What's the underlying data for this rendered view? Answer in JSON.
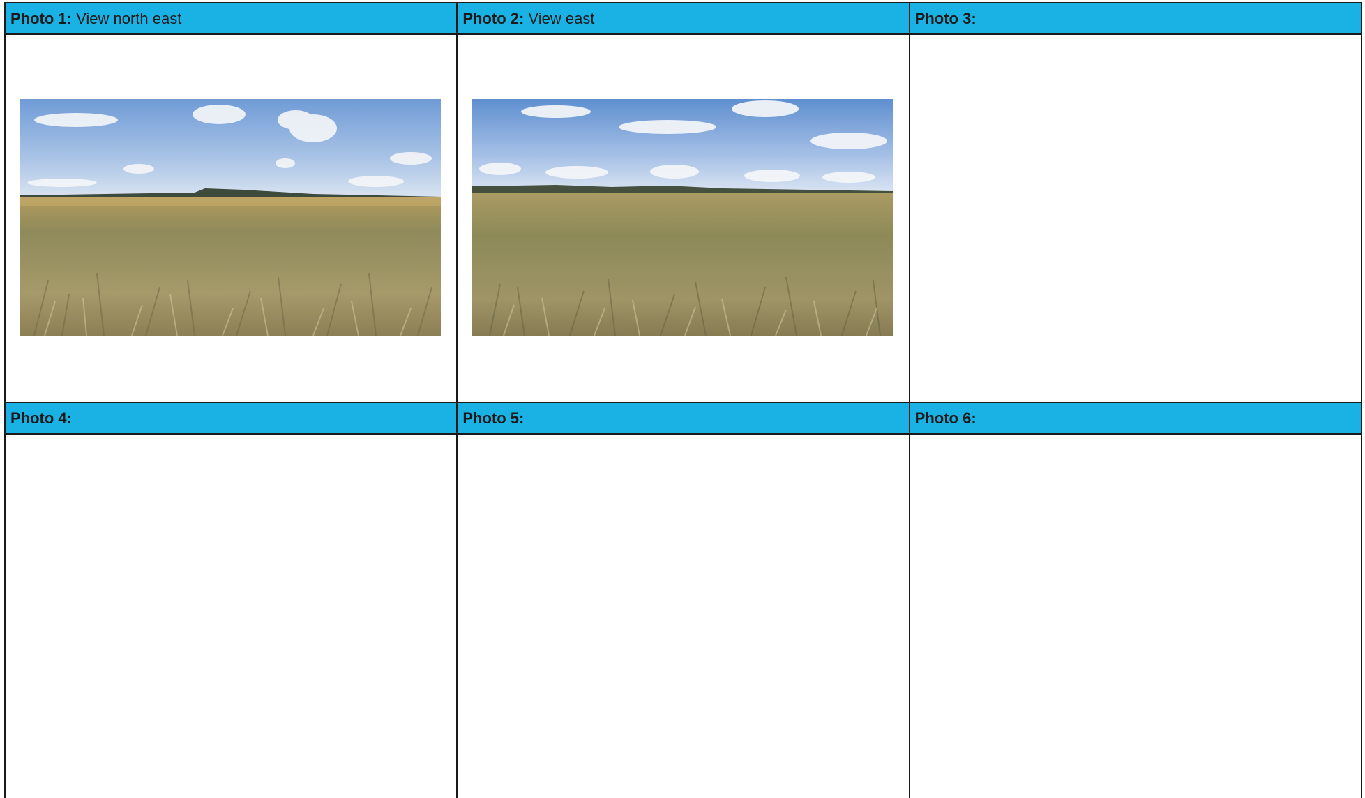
{
  "photos": [
    {
      "label": "Photo 1:",
      "caption": " View north east",
      "has_image": true
    },
    {
      "label": "Photo 2:",
      "caption": " View east",
      "has_image": true
    },
    {
      "label": "Photo 3:",
      "caption": "",
      "has_image": false
    },
    {
      "label": "Photo 4:",
      "caption": "",
      "has_image": false
    },
    {
      "label": "Photo 5:",
      "caption": "",
      "has_image": false
    },
    {
      "label": "Photo 6:",
      "caption": "",
      "has_image": false
    }
  ],
  "colors": {
    "header_fill": "#1ab1e5",
    "border": "#1a1a1a",
    "sky": "#7fa8da",
    "cloud": "#f2f4f6",
    "grass": "#9e9262"
  }
}
